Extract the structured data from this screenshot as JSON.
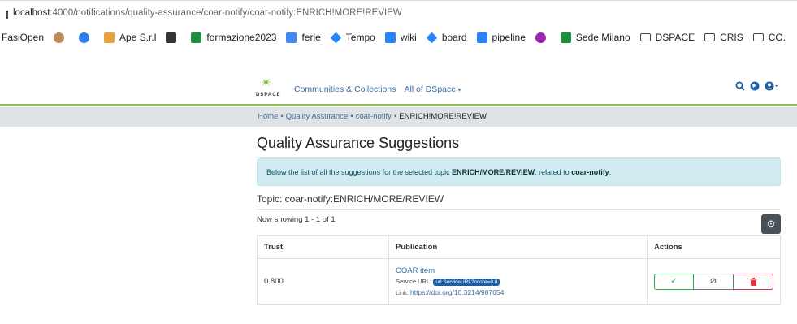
{
  "browser": {
    "url_host": "localhost",
    "url_rest": ":4000/notifications/quality-assurance/coar-notify/coar-notify:ENRICH!MORE!REVIEW",
    "bookmarks": [
      {
        "label": "FasiOpen",
        "icon": "none",
        "color": ""
      },
      {
        "label": "",
        "icon": "avatar-icon",
        "color": "#c08a5a"
      },
      {
        "label": "",
        "icon": "globe-icon",
        "color": "#2b7de9"
      },
      {
        "label": "Ape S.r.l",
        "icon": "site-icon",
        "color": "#e9a23b"
      },
      {
        "label": "",
        "icon": "fb-icon",
        "color": "#333333"
      },
      {
        "label": "formazione2023",
        "icon": "sheet-icon",
        "color": "#1e8e3e"
      },
      {
        "label": "ferie",
        "icon": "apps-icon",
        "color": "#4285f4"
      },
      {
        "label": "Tempo",
        "icon": "diamond-icon",
        "color": "#2684ff"
      },
      {
        "label": "wiki",
        "icon": "confluence-icon",
        "color": "#2684ff"
      },
      {
        "label": "board",
        "icon": "diamond-icon",
        "color": "#2684ff"
      },
      {
        "label": "pipeline",
        "icon": "bitbucket-icon",
        "color": "#2684ff"
      },
      {
        "label": "",
        "icon": "circle-icon",
        "color": "#9c27b0"
      },
      {
        "label": "Sede Milano",
        "icon": "sheet-icon",
        "color": "#1e8e3e"
      },
      {
        "label": "DSPACE",
        "icon": "folder-icon",
        "color": ""
      },
      {
        "label": "CRIS",
        "icon": "folder-icon",
        "color": ""
      },
      {
        "label": "CO.",
        "icon": "folder-icon",
        "color": ""
      }
    ]
  },
  "header": {
    "logo_text": "DSPACE",
    "nav_communities": "Communities & Collections",
    "nav_all": "All of DSpace"
  },
  "breadcrumb": {
    "home": "Home",
    "qa": "Quality Assurance",
    "source": "coar-notify",
    "current": "ENRICH!MORE!REVIEW"
  },
  "page": {
    "title": "Quality Assurance Suggestions",
    "alert_prefix": "Below the list of all the suggestions for the selected topic ",
    "alert_topic": "ENRICH/MORE/REVIEW",
    "alert_mid": ", related to ",
    "alert_source": "coar-notify",
    "alert_suffix": ".",
    "topic_label": "Topic: coar-notify:ENRICH/MORE/REVIEW",
    "showing": "Now showing 1 - 1 of 1"
  },
  "table": {
    "headers": {
      "trust": "Trust",
      "publication": "Publication",
      "actions": "Actions"
    },
    "rows": [
      {
        "trust": "0.800",
        "title": "COAR item",
        "service_label": "Service URL:",
        "service_value": "url.ServiceURL?score=0.8",
        "link_label": "Link:",
        "link_value": "https://doi.org/10.3214/987654"
      }
    ]
  },
  "colors": {
    "accent": "#8bc34a",
    "link": "#3a6fa0",
    "alert_bg": "#d1ecf1"
  }
}
